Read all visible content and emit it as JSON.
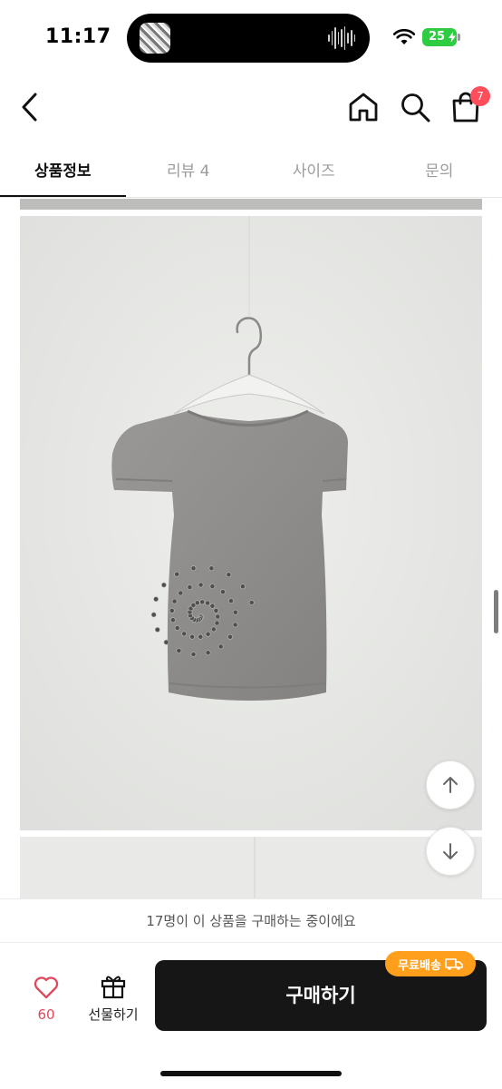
{
  "status_bar": {
    "time": "11:17",
    "battery": "25"
  },
  "header": {
    "back_icon": "chevron-left-icon",
    "home_icon": "home-icon",
    "search_icon": "search-icon",
    "cart_icon": "shopping-bag-icon",
    "cart_count": "7"
  },
  "tabs": [
    {
      "label": "상품정보",
      "active": true
    },
    {
      "label": "리뷰 4",
      "active": false
    },
    {
      "label": "사이즈",
      "active": false
    },
    {
      "label": "문의",
      "active": false
    }
  ],
  "scroll_buttons": {
    "up_icon": "arrow-up-icon",
    "down_icon": "arrow-down-icon"
  },
  "viewer_banner": "17명이 이 상품을 구매하는 중이에요",
  "bottom_bar": {
    "like_count": "60",
    "gift_label": "선물하기",
    "buy_label": "구매하기",
    "shipping_tag": "무료배송"
  },
  "colors": {
    "accent": "#ff9f1c",
    "badge": "#ff4e5b",
    "like": "#e0485c",
    "buy_button": "#161616"
  }
}
